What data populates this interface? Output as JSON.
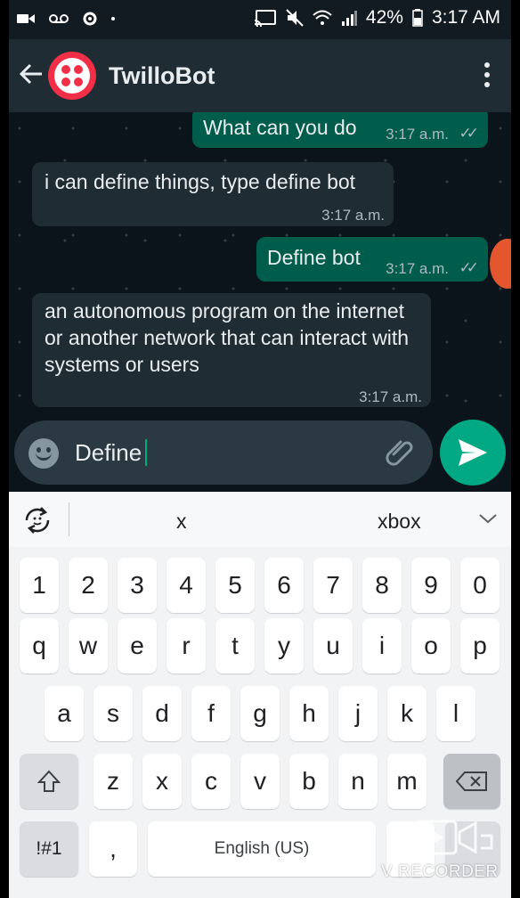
{
  "status_bar": {
    "battery": "42%",
    "time": "3:17 AM"
  },
  "header": {
    "contact_name": "TwilloBot"
  },
  "messages": [
    {
      "direction": "out",
      "text": "What can you do",
      "time": "3:17 a.m."
    },
    {
      "direction": "in",
      "text": "i can define things, type define bot",
      "time": "3:17 a.m."
    },
    {
      "direction": "out",
      "text": "Define bot",
      "time": "3:17 a.m."
    },
    {
      "direction": "in",
      "text": "an autonomous program on the internet or another network that can interact with systems or users",
      "time": "3:17 a.m."
    }
  ],
  "composer": {
    "text": "Define"
  },
  "keyboard": {
    "suggestions": [
      "x",
      "xbox"
    ],
    "number_row": [
      "1",
      "2",
      "3",
      "4",
      "5",
      "6",
      "7",
      "8",
      "9",
      "0"
    ],
    "row1": [
      "q",
      "w",
      "e",
      "r",
      "t",
      "y",
      "u",
      "i",
      "o",
      "p"
    ],
    "row2": [
      "a",
      "s",
      "d",
      "f",
      "g",
      "h",
      "j",
      "k",
      "l"
    ],
    "row3": [
      "z",
      "x",
      "c",
      "v",
      "b",
      "n",
      "m"
    ],
    "symbols_key": "!#1",
    "comma_key": ",",
    "space_label": "English (US)"
  },
  "watermark": {
    "text": "V RECORDER"
  },
  "colors": {
    "app_bar": "#1f2c34",
    "chat_bg": "#0b141a",
    "incoming_bubble": "#202c33",
    "outgoing_bubble": "#005c4b",
    "accent": "#00a884",
    "twilio_red": "#f22f46"
  }
}
